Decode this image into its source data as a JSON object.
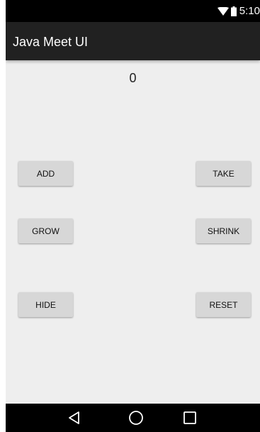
{
  "status_bar": {
    "time": "5:10",
    "icons": [
      "wifi-icon",
      "battery-icon"
    ]
  },
  "app_bar": {
    "title": "Java Meet UI"
  },
  "main": {
    "counter_value": "0",
    "buttons": {
      "add": "ADD",
      "take": "TAKE",
      "grow": "GROW",
      "shrink": "SHRINK",
      "hide": "HIDE",
      "reset": "RESET"
    }
  },
  "nav_bar": {
    "icons": [
      "back-icon",
      "home-icon",
      "recent-apps-icon"
    ]
  },
  "colors": {
    "status_bar": "#000000",
    "app_bar": "#212121",
    "background": "#eeeeee",
    "button": "#d7d7d7",
    "nav_bar": "#000000"
  }
}
